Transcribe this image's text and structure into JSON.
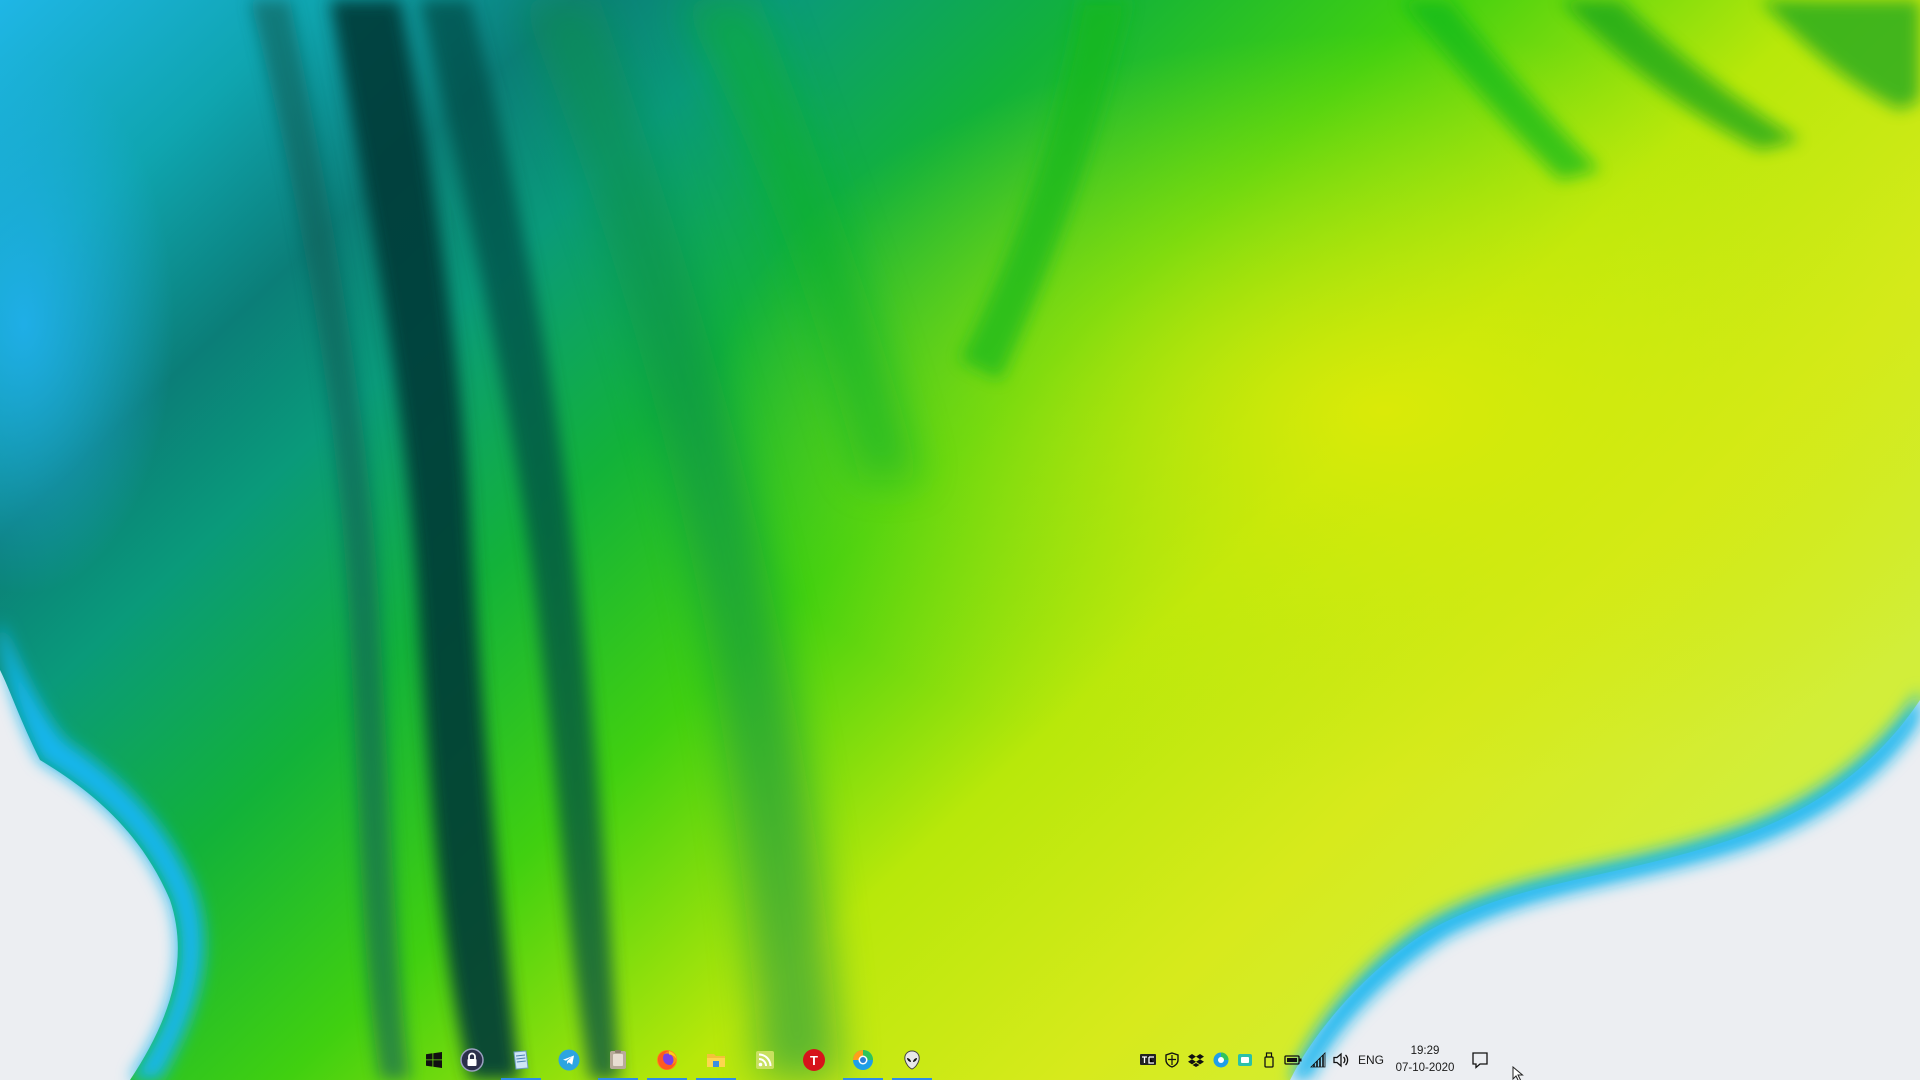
{
  "desktop": {
    "wallpaper_colors": {
      "background": "#eceef2",
      "cyan": "#1ab4e8",
      "teal": "#0a8a86",
      "dark_teal": "#074846",
      "green": "#18c000",
      "lime": "#c4ea0a",
      "yellow_green": "#d8e820"
    }
  },
  "taskbar": {
    "pinned_apps": [
      {
        "name": "start",
        "icon": "windows-logo-icon"
      },
      {
        "name": "lock-app",
        "icon": "lock-icon"
      },
      {
        "name": "notepad-app",
        "icon": "notepad-icon"
      },
      {
        "name": "telegram",
        "icon": "telegram-icon"
      },
      {
        "name": "clipboard-app",
        "icon": "clipboard-icon"
      },
      {
        "name": "firefox",
        "icon": "firefox-icon"
      },
      {
        "name": "file-explorer",
        "icon": "folder-icon"
      },
      {
        "name": "rss-reader",
        "icon": "rss-icon"
      },
      {
        "name": "t-app",
        "icon": "t-letter-icon",
        "letter": "T"
      },
      {
        "name": "edge",
        "icon": "edge-icon"
      },
      {
        "name": "alien-app",
        "icon": "alien-icon"
      }
    ],
    "tray": {
      "language": "ENG",
      "time": "19:29",
      "date": "07-10-2020"
    },
    "accent_color": "#2f8ce8"
  }
}
